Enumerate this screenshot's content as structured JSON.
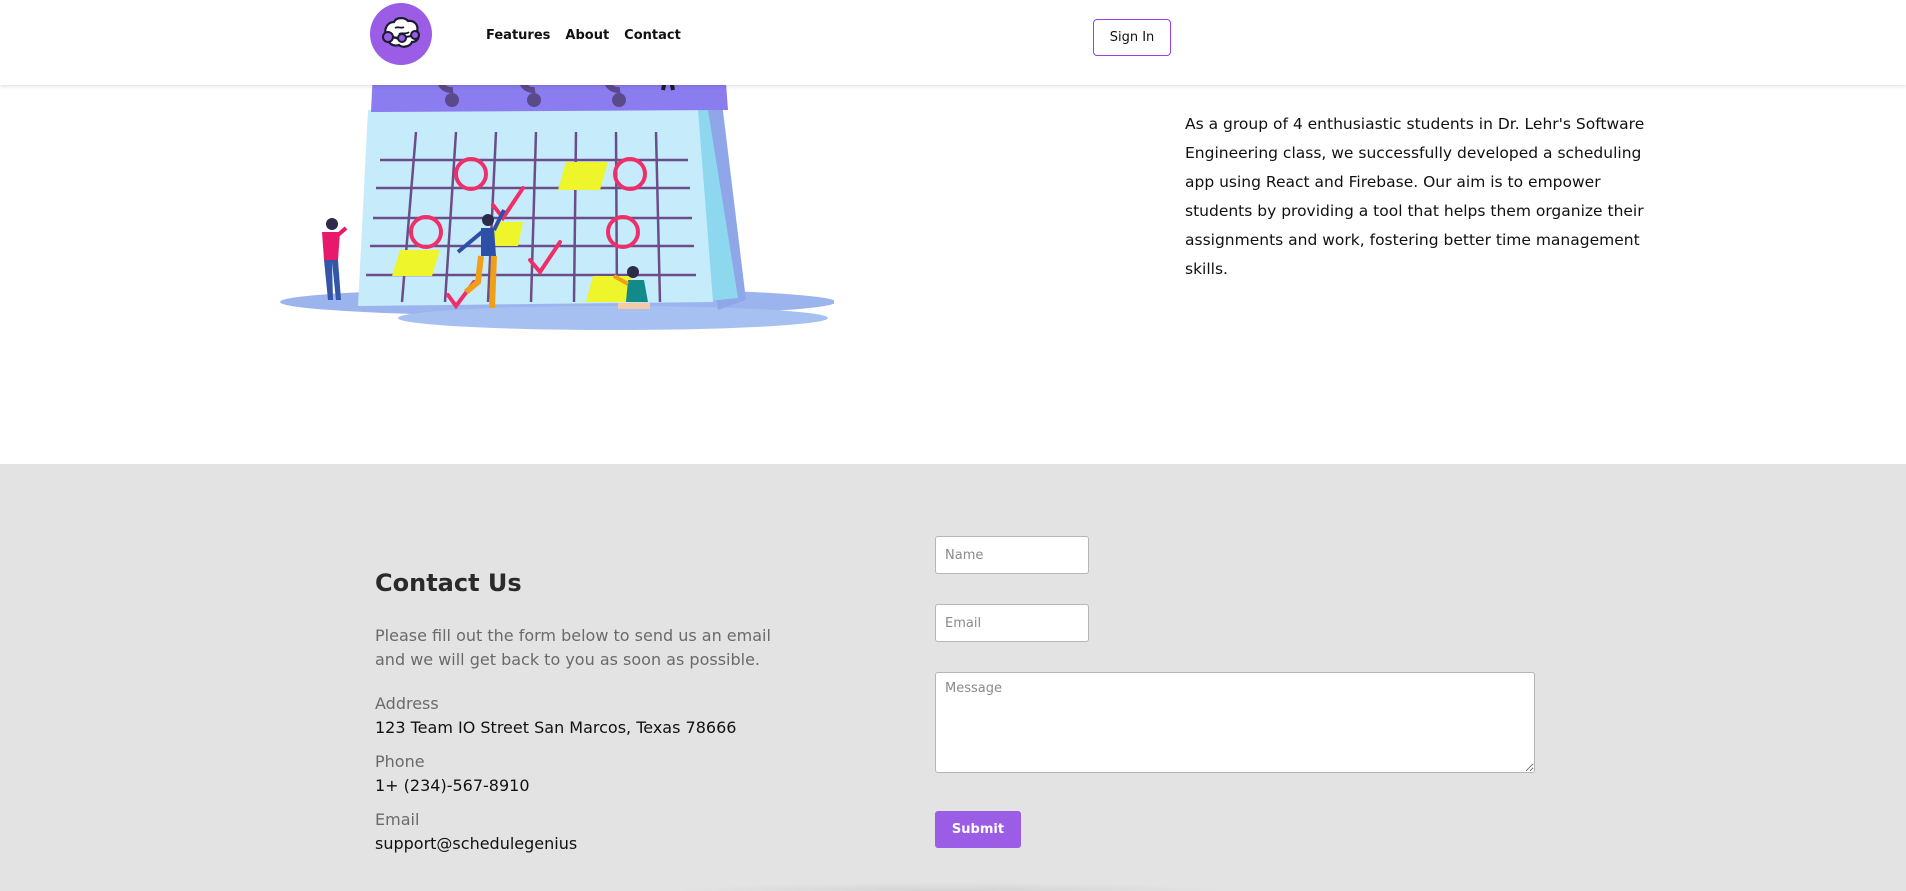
{
  "nav": {
    "links": [
      "Features",
      "About",
      "Contact"
    ],
    "signin_label": "Sign In"
  },
  "about": {
    "text": "As a group of 4 enthusiastic students in Dr. Lehr's Software Engineering class, we successfully developed a scheduling app using React and Firebase. Our aim is to empower students by providing a tool that helps them organize their assignments and work, fostering better time management skills."
  },
  "contact": {
    "title": "Contact Us",
    "description": "Please fill out the form below to send us an email and we will get back to you as soon as possible.",
    "address_label": "Address",
    "address_value": "123 Team IO Street San Marcos, Texas 78666",
    "phone_label": "Phone",
    "phone_value": "1+ (234)-567-8910",
    "email_label": "Email",
    "email_value": "support@schedulegenius",
    "form": {
      "name_placeholder": "Name",
      "email_placeholder": "Email",
      "message_placeholder": "Message",
      "submit_label": "Submit"
    }
  },
  "colors": {
    "accent": "#9b5de5",
    "section_bg": "#e3e3e3"
  }
}
